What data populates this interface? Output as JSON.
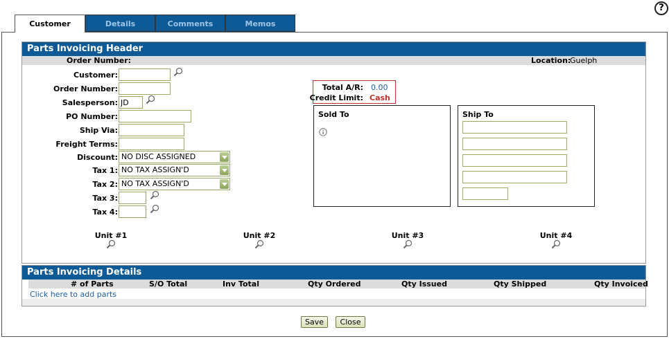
{
  "help": {
    "label": "?"
  },
  "tabs": [
    {
      "label": "Customer",
      "active": true
    },
    {
      "label": "Details",
      "active": false
    },
    {
      "label": "Comments",
      "active": false
    },
    {
      "label": "Memos",
      "active": false
    }
  ],
  "header_panel": {
    "title": "Parts Invoicing Header",
    "order_number_label": "Order Number:",
    "location_label": "Location:",
    "location_value": "Guelph"
  },
  "fields": {
    "customer": {
      "label": "Customer:",
      "value": ""
    },
    "order_number": {
      "label": "Order Number:",
      "value": ""
    },
    "salesperson": {
      "label": "Salesperson:",
      "value": "JD"
    },
    "po_number": {
      "label": "PO Number:",
      "value": ""
    },
    "ship_via": {
      "label": "Ship Via:",
      "value": ""
    },
    "freight_terms": {
      "label": "Freight Terms:",
      "value": ""
    },
    "discount": {
      "label": "Discount:",
      "value": "NO DISC ASSIGNED"
    },
    "tax1": {
      "label": "Tax 1:",
      "value": "NO TAX ASSIGN'D"
    },
    "tax2": {
      "label": "Tax 2:",
      "value": "NO TAX ASSIGN'D"
    },
    "tax3": {
      "label": "Tax 3:",
      "value": ""
    },
    "tax4": {
      "label": "Tax 4:",
      "value": ""
    }
  },
  "account": {
    "total_ar_label": "Total A/R:",
    "total_ar_value": "0.00",
    "credit_limit_label": "Credit Limit:",
    "credit_limit_value": "Cash"
  },
  "sold_to": {
    "title": "Sold To"
  },
  "ship_to": {
    "title": "Ship To",
    "lines": [
      "",
      "",
      "",
      "",
      ""
    ]
  },
  "units": [
    "Unit #1",
    "Unit #2",
    "Unit #3",
    "Unit #4"
  ],
  "details_panel": {
    "title": "Parts Invoicing Details",
    "columns": [
      "# of Parts",
      "S/O Total",
      "Inv Total",
      "Qty Ordered",
      "Qty Issued",
      "Qty Shipped",
      "Qty Invoiced"
    ],
    "add_link": "Click here to add parts"
  },
  "buttons": {
    "save": "Save",
    "close": "Close"
  },
  "colors": {
    "header_blue": "#0e5a96",
    "link_blue": "#1a5fa8",
    "cash_red": "#c0302a",
    "border_red": "#c0302a"
  }
}
